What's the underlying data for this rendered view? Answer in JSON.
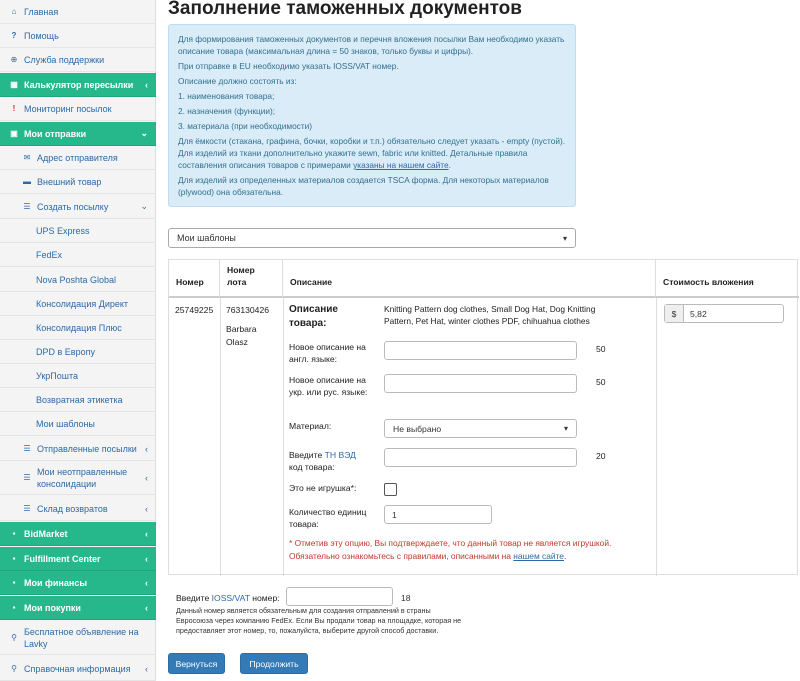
{
  "sidebar": {
    "items": [
      {
        "label": "Главная",
        "icon": "home-icon",
        "glyph": "⌂"
      },
      {
        "label": "Помощь",
        "icon": "question-icon",
        "glyph": "?"
      },
      {
        "label": "Служба поддержки",
        "icon": "lifebuoy-icon",
        "glyph": "⊕"
      },
      {
        "label": "Калькулятор пересылки",
        "icon": "calculator-icon",
        "glyph": "▦"
      },
      {
        "label": "Мониторинг посылок",
        "icon": "alert-icon",
        "glyph": "!"
      },
      {
        "label": "Мои отправки",
        "icon": "cart-icon",
        "glyph": "🛒"
      },
      {
        "label": "Адрес отправителя",
        "icon": "envelope-icon",
        "glyph": "✉"
      },
      {
        "label": "Внешний товар",
        "icon": "box-icon",
        "glyph": "▬"
      },
      {
        "label": "Создать посылку",
        "icon": "list-icon",
        "glyph": "☰"
      },
      {
        "label": "UPS Express"
      },
      {
        "label": "FedEx"
      },
      {
        "label": "Nova Poshta Global"
      },
      {
        "label": "Консолидация Директ"
      },
      {
        "label": "Консолидация Плюс"
      },
      {
        "label": "DPD в Европу"
      },
      {
        "label": "УкрПошта"
      },
      {
        "label": "Возвратная этикетка"
      },
      {
        "label": "Мои шаблоны"
      },
      {
        "label": "Отправленные посылки",
        "icon": "list-icon",
        "glyph": "☰"
      },
      {
        "label": "Мои неотправленные консолидации",
        "icon": "list-icon",
        "glyph": "☰"
      },
      {
        "label": "Склад возвратов",
        "icon": "list-icon",
        "glyph": "☰"
      },
      {
        "label": "BidMarket",
        "icon": "gavel-icon",
        "glyph": "▪"
      },
      {
        "label": "Fulfillment Center",
        "icon": "warehouse-icon",
        "glyph": "▪"
      },
      {
        "label": "Мои финансы",
        "icon": "wallet-icon",
        "glyph": "▪"
      },
      {
        "label": "Мои покупки",
        "icon": "cart-icon",
        "glyph": "▪"
      },
      {
        "label": "Бесплатное объявление на Lavky",
        "icon": "link-icon",
        "glyph": "⚲"
      },
      {
        "label": "Справочная информация",
        "icon": "link-icon",
        "glyph": "⚲"
      }
    ],
    "chevron": "‹"
  },
  "page": {
    "title": "Заполнение таможенных документов"
  },
  "info": {
    "p1": "Для формирования таможенных документов и перечня вложения посылки Вам необходимо указать описание товара (максимальная длина = 50 знаков, только буквы и цифры).",
    "p2": "При отправке в EU необходимо указать IOSS/VAT номер.",
    "p3": "Описание должно состоять из:",
    "p4": "1. наименования товара;",
    "p5": "2. назначения (функции);",
    "p6": "3. материала (при необходимости)",
    "p7a": "Для ёмкости (стакана, графина, бочки, коробки и т.п.) обязательно следует указать - empty (пустой). Для изделий из ткани дополнительно укажите sewn, fabric или knitted. Детальные правила составления описания товаров с примерами ",
    "p7link": "указаны на нашем сайте",
    "p7b": ".",
    "p8": "Для изделий из определенных материалов создается TSCA форма. Для некоторых материалов (plywood) она обязательна."
  },
  "templates": {
    "selected": "Мои шаблоны"
  },
  "table": {
    "headers": {
      "number": "Номер",
      "lot": "Номер лота",
      "desc": "Описание",
      "value": "Стоимость вложения"
    },
    "row": {
      "number": "25749225",
      "lot": "763130426",
      "buyer": "Barbara Olasz",
      "desc_title": "Описание товара:",
      "desc_text": "Knitting Pattern dog clothes, Small Dog Hat, Dog Knitting Pattern, Pet Hat, winter clothes PDF, chihuahua clothes",
      "currency": "$",
      "value": "5,82"
    },
    "fields": {
      "new_en_label": "Новое описание на англ. языке:",
      "new_en_count": "50",
      "new_ru_label": "Новое описание на укр. или рус. языке:",
      "new_ru_count": "50",
      "material_label": "Материал:",
      "material_value": "Не выбрано",
      "hs_prefix": "Введите ",
      "hs_link": "ТН ВЭД",
      "hs_suffix": "код товара:",
      "hs_count": "20",
      "not_toy_label": "Это не игрушка*:",
      "qty_label": "Количество единиц товара:",
      "qty_value": "1"
    },
    "note_a": "* Отметив эту опцию, Вы подтверждаете, что данный товар не является игрушкой. Обязательно ознакомьтесь с правилами, описанными на ",
    "note_link": "нашем сайте",
    "note_b": "."
  },
  "ioss": {
    "prefix": "Введите ",
    "link": "IOSS/VAT",
    "suffix": " номер:",
    "count": "18",
    "desc": "Данный номер является обязательным для создания отправлений в страны Евросоюза через компанию FedEx. Если Вы продали товар на площадке, которая не предоставляет этот номер, то, пожалуйста, выберите другой способ доставки."
  },
  "buttons": {
    "back": "Вернуться",
    "next": "Продолжить"
  },
  "colors": {
    "accent": "#26b88a",
    "link": "#2a6aa8",
    "info_bg": "#d9ecf7",
    "button": "#337ab7",
    "note": "#c0392b"
  }
}
